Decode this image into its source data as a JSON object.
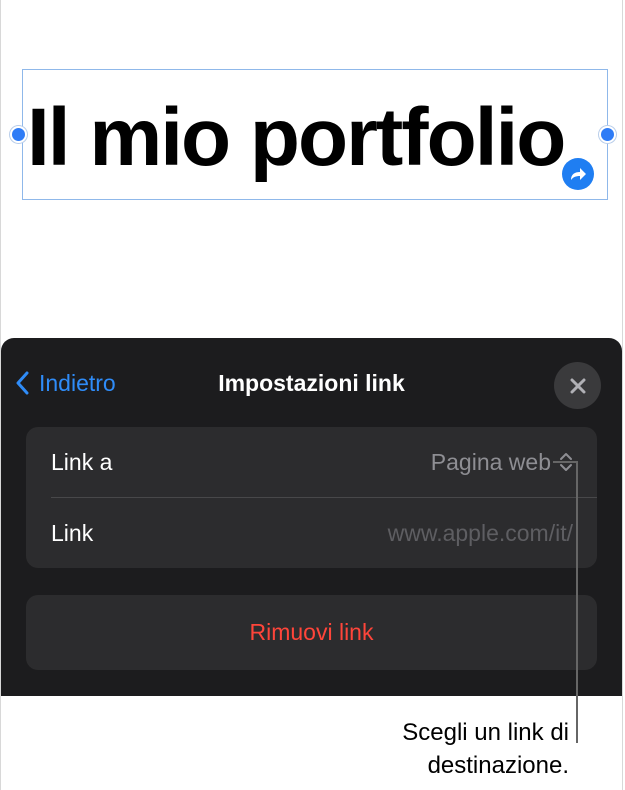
{
  "canvas": {
    "title_text": "Il mio portfolio"
  },
  "sheet": {
    "back_label": "Indietro",
    "title": "Impostazioni link",
    "close_icon": "close-icon",
    "rows": [
      {
        "label": "Link a",
        "value": "Pagina web",
        "icon": "up-down-chevron-icon"
      },
      {
        "label": "Link",
        "placeholder": "www.apple.com/it/"
      }
    ],
    "remove_label": "Rimuovi link"
  },
  "callout": {
    "line1": "Scegli un link di",
    "line2": "destinazione."
  },
  "colors": {
    "accent": "#2f8cf8",
    "destructive": "#ff453a",
    "sheet_background": "#1c1c1e",
    "row_background": "#2c2c2e"
  }
}
